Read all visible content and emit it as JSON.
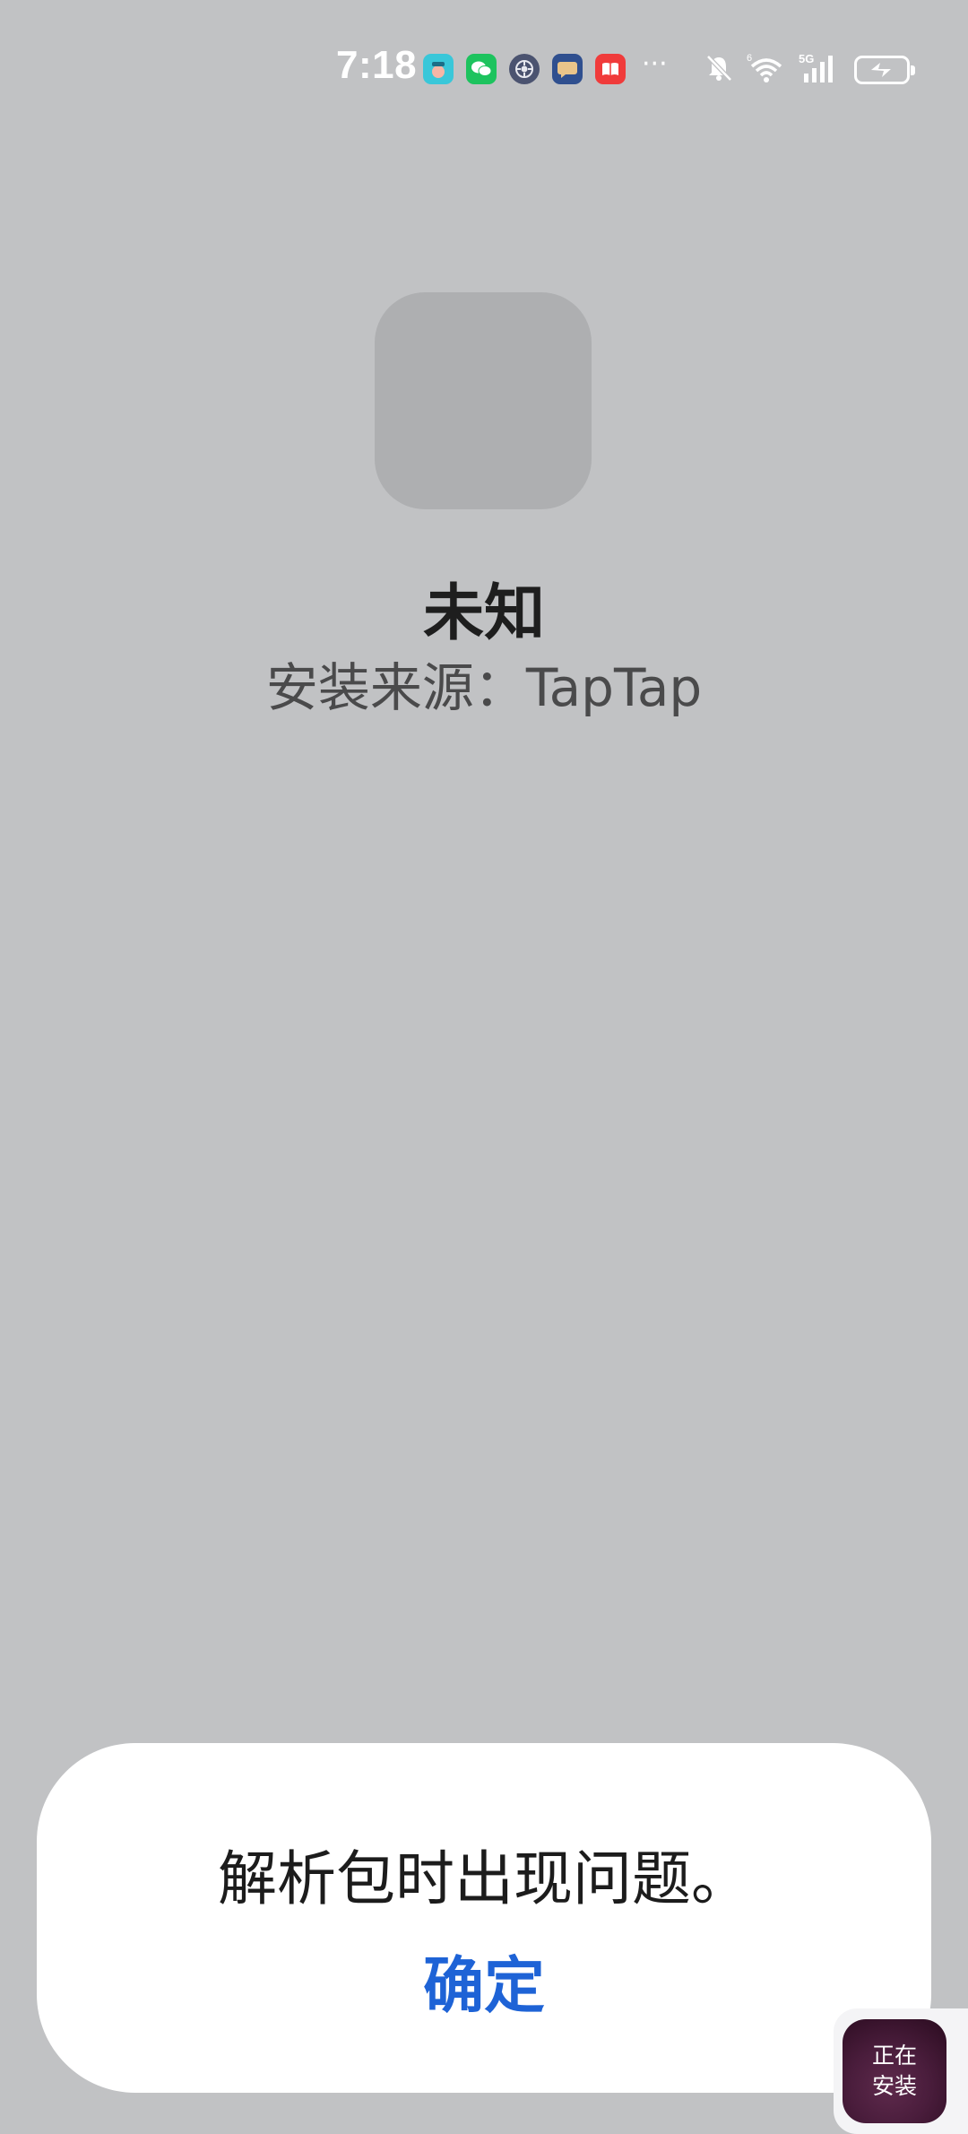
{
  "status_bar": {
    "time": "7:18",
    "notification_icons": [
      "ai-app-icon",
      "wechat-icon",
      "settings-icon",
      "chat-bubble-icon",
      "red-book-icon"
    ],
    "more": "···",
    "system_icons": [
      "mute-bell-icon",
      "wifi-icon",
      "signal-5g-icon",
      "battery-charging-icon"
    ]
  },
  "app": {
    "name": "未知",
    "source": "安装来源：TapTap"
  },
  "dialog": {
    "message": "解析包时出现问题。",
    "confirm_label": "确定"
  },
  "floating_widget": {
    "label": "正在\n安装"
  },
  "colors": {
    "background": "#c1c2c4",
    "accent": "#1e63d6",
    "dialog": "#ffffff"
  }
}
